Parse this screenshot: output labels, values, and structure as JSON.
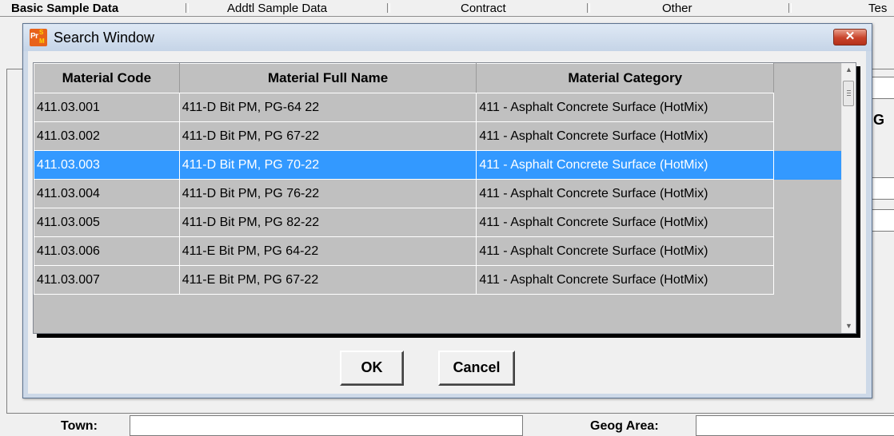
{
  "background": {
    "tabs": [
      "Basic Sample Data",
      "Addtl Sample Data",
      "Contract",
      "Other",
      "Tes"
    ],
    "fields": [
      {
        "label": "Town:"
      },
      {
        "label": "Geog Area:"
      }
    ],
    "side_letter": "G"
  },
  "dialog": {
    "title": "Search Window",
    "close_glyph": "✕",
    "icon_name": "prsm-app-icon",
    "grid": {
      "columns": [
        "Material Code",
        "Material Full Name",
        "Material Category"
      ],
      "rows": [
        {
          "code": "411.03.001",
          "name": "411-D Bit PM, PG-64 22",
          "category": "411 - Asphalt Concrete Surface (HotMix)"
        },
        {
          "code": "411.03.002",
          "name": "411-D Bit PM, PG 67-22",
          "category": "411 - Asphalt Concrete Surface (HotMix)"
        },
        {
          "code": "411.03.003",
          "name": "411-D Bit PM, PG 70-22",
          "category": "411 - Asphalt Concrete Surface (HotMix)"
        },
        {
          "code": "411.03.004",
          "name": "411-D Bit PM, PG 76-22",
          "category": "411 - Asphalt Concrete Surface (HotMix)"
        },
        {
          "code": "411.03.005",
          "name": "411-D Bit PM, PG 82-22",
          "category": "411 - Asphalt Concrete Surface (HotMix)"
        },
        {
          "code": "411.03.006",
          "name": "411-E Bit PM, PG 64-22",
          "category": "411 - Asphalt Concrete Surface (HotMix)"
        },
        {
          "code": "411.03.007",
          "name": "411-E Bit PM, PG 67-22",
          "category": "411 - Asphalt Concrete Surface (HotMix)"
        }
      ],
      "selected_row_index": 2
    },
    "buttons": {
      "ok": "OK",
      "cancel": "Cancel"
    }
  },
  "colors": {
    "selection": "#3399ff",
    "grid_background": "#c0c0c0",
    "close_button": "#c8432a",
    "icon": "#e8621a"
  }
}
